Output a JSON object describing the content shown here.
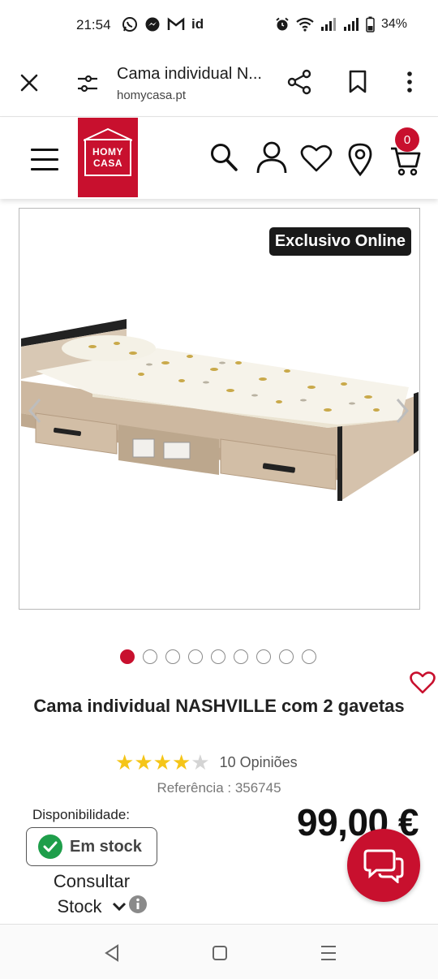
{
  "status_bar": {
    "time": "21:54",
    "app_icons": [
      "whatsapp-icon",
      "messenger-icon",
      "gmail-icon",
      "id-icon"
    ],
    "id_text": "id",
    "battery": "34%"
  },
  "browser": {
    "title": "Cama individual N...",
    "url": "homycasa.pt"
  },
  "header": {
    "logo_line1": "HOMY",
    "logo_line2": "CASA",
    "cart_count": "0",
    "brand_color": "#c8102e"
  },
  "product": {
    "badge": "Exclusivo Online",
    "image_count": 9,
    "active_image": 1,
    "title": "Cama individual NASHVILLE com 2 gavetas",
    "rating_value": 4,
    "rating_max": 5,
    "reviews": "10 Opiniões",
    "reference": "Referência : 356745",
    "availability_label": "Disponibilidade:",
    "stock_status": "Em stock",
    "price": "99,00 €",
    "consult_line1": "Consultar",
    "consult_line2": "Stock"
  }
}
